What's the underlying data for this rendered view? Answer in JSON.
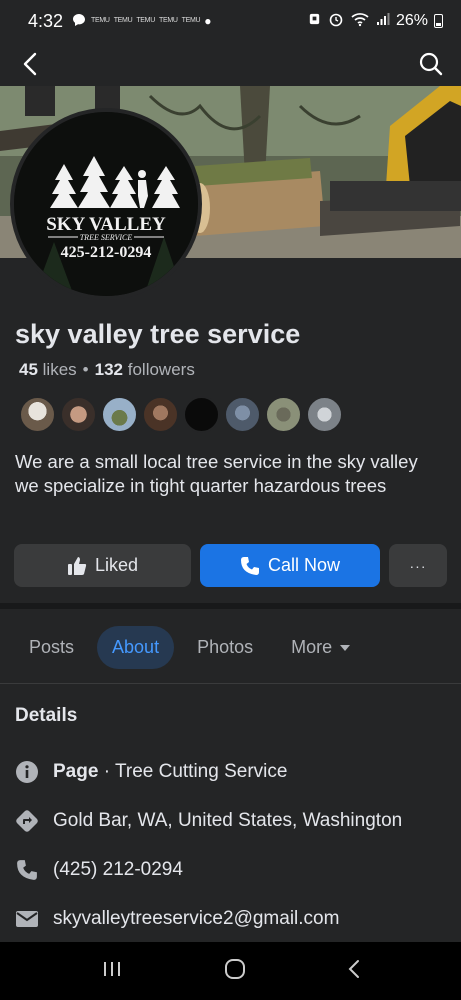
{
  "status_bar": {
    "time": "4:32",
    "notif_app_labels": [
      "TEMU",
      "TEMU",
      "TEMU",
      "TEMU",
      "TEMU"
    ],
    "battery": "26%"
  },
  "profile": {
    "name": "sky valley tree service",
    "likes_count": "45",
    "likes_label": "likes",
    "followers_count": "132",
    "followers_label": "followers",
    "about": "We are a small local tree service in the sky valley we specialize in tight quarter hazardous trees",
    "logo_title": "SKY VALLEY",
    "logo_sub": "TREE SERVICE",
    "logo_phone": "425-212-0294"
  },
  "actions": {
    "liked_label": "Liked",
    "call_label": "Call Now",
    "more_label": "···"
  },
  "tabs": [
    {
      "label": "Posts"
    },
    {
      "label": "About"
    },
    {
      "label": "Photos"
    },
    {
      "label": "More"
    }
  ],
  "details": {
    "title": "Details",
    "page_label": "Page",
    "category": "· Tree Cutting Service",
    "location": "Gold Bar, WA, United States, Washington",
    "phone": "(425) 212-0294",
    "email": "skyvalleytreeservice2@gmail.com"
  },
  "colors": {
    "background": "#242526",
    "accent": "#1b74e4",
    "active_tab_bg": "#263951",
    "active_tab_text": "#4599ff"
  }
}
